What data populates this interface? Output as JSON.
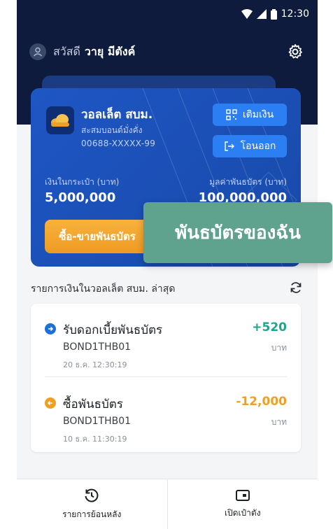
{
  "status": {
    "time": "12:30"
  },
  "header": {
    "greeting": "สวัสดี",
    "user_name": "วายุ มีตังค์"
  },
  "wallet": {
    "name": "วอลเล็ต สบม.",
    "subtitle": "สะสมบอนด์มั่งคั่ง",
    "account": "00688-XXXXX-99",
    "topup_label": "เติมเงิน",
    "transfer_label": "โอนออก",
    "balance_label": "เงินในกระเป๋า (บาท)",
    "balance_value": "5,000,000",
    "bond_label": "มูลค่าพันธบัตร (บาท)",
    "bond_value": "100,000,000",
    "trade_label": "ซื้อ-ขายพันธบัตร"
  },
  "overlay": {
    "label": "พันธบัตรของฉัน"
  },
  "recent": {
    "title": "รายการเงินในวอลเล็ต สบม. ล่าสุด",
    "transactions": [
      {
        "title": "รับดอกเบี้ยพันธบัตร",
        "code": "BOND1THB01",
        "time": "20 ธ.ค. 12:30:19",
        "amount": "+520",
        "unit": "บาท",
        "color": "#1fa58a"
      },
      {
        "title": "ซื้อพันธบัตร",
        "code": "BOND1THB01",
        "time": "10 ธ.ค. 11:30:19",
        "amount": "-12,000",
        "unit": "บาท",
        "color": "#f0a020"
      }
    ]
  },
  "nav": {
    "history_label": "รายการย้อนหลัง",
    "pocket_label": "เปิดเป๋าตัง"
  },
  "colors": {
    "header_bg": "#0e1b3d",
    "card_blue": "#1e56c4",
    "accent_orange": "#f7b23d",
    "income_green": "#1fa58a",
    "overlay_green": "#5fa28d"
  }
}
